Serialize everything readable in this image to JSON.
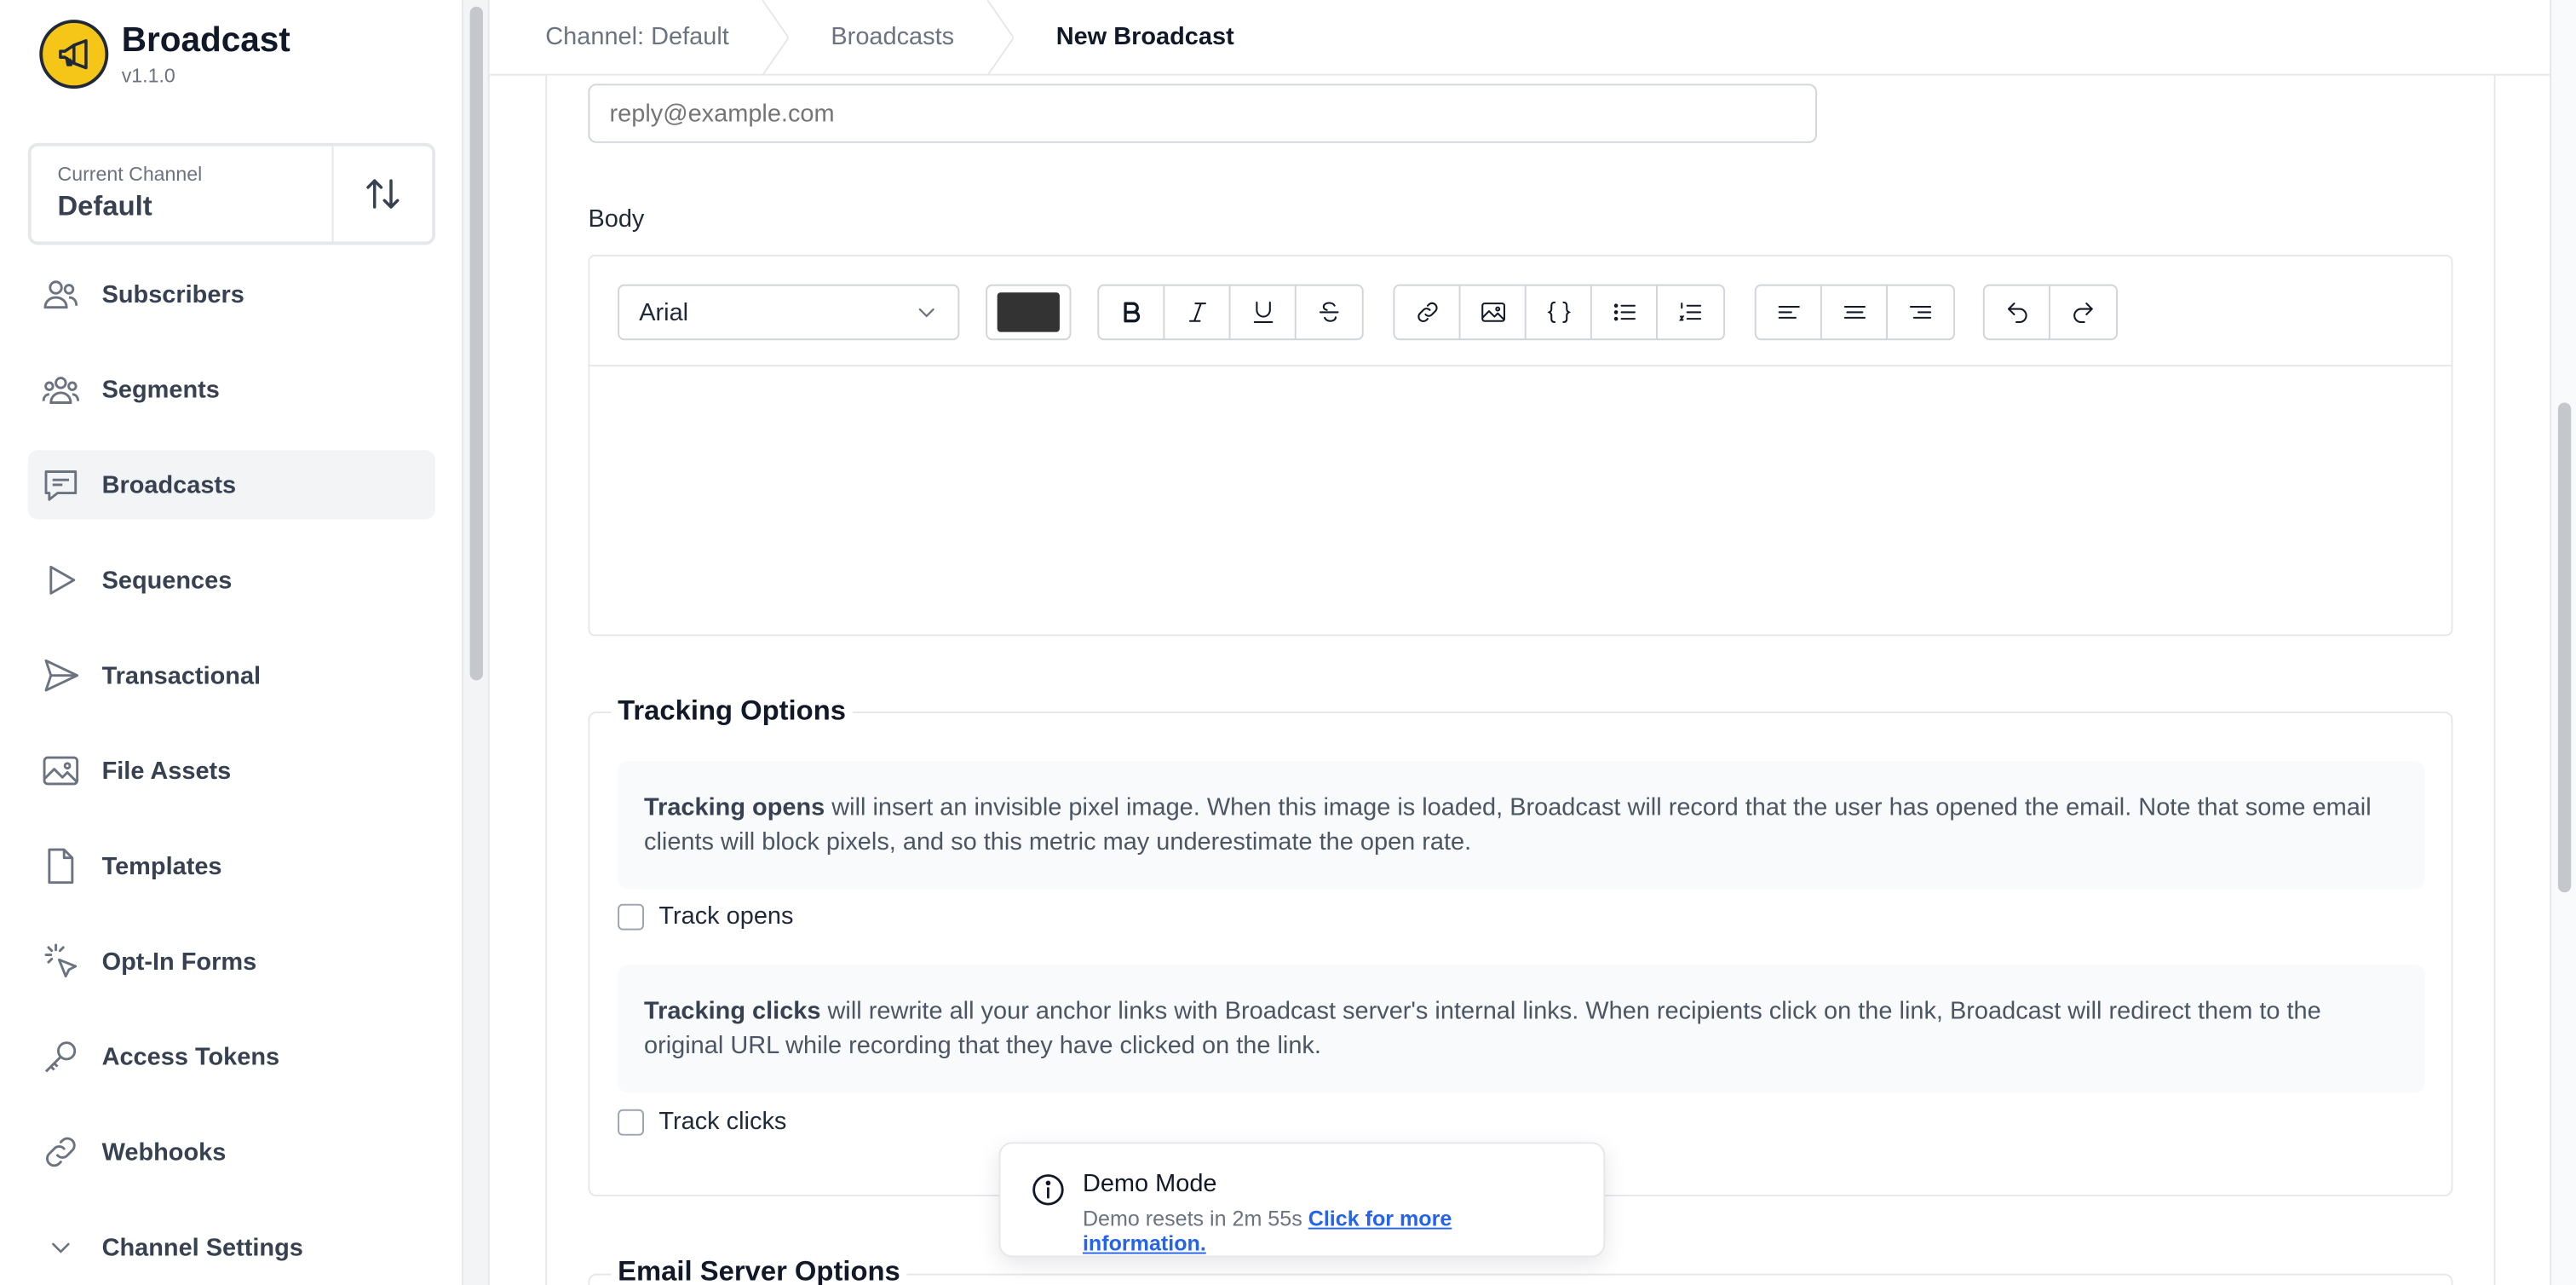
{
  "app": {
    "name": "Broadcast",
    "version": "v1.1.0",
    "brand_color": "#f5c518"
  },
  "channel": {
    "label": "Current Channel",
    "name": "Default",
    "switch_icon": "arrows-up-down-icon"
  },
  "sidebar": {
    "items": [
      {
        "label": "Subscribers",
        "icon": "users-icon"
      },
      {
        "label": "Segments",
        "icon": "user-group-icon"
      },
      {
        "label": "Broadcasts",
        "icon": "chat-bubble-icon",
        "active": true
      },
      {
        "label": "Sequences",
        "icon": "play-icon"
      },
      {
        "label": "Transactional",
        "icon": "paper-airplane-icon"
      },
      {
        "label": "File Assets",
        "icon": "photo-icon"
      },
      {
        "label": "Templates",
        "icon": "document-icon"
      },
      {
        "label": "Opt-In Forms",
        "icon": "cursor-click-icon"
      },
      {
        "label": "Access Tokens",
        "icon": "key-icon"
      },
      {
        "label": "Webhooks",
        "icon": "link-icon"
      },
      {
        "label": "Channel Settings",
        "icon": "chevron-down-icon"
      }
    ]
  },
  "breadcrumb": [
    "Channel: Default",
    "Broadcasts",
    "New Broadcast"
  ],
  "form": {
    "reply_to_placeholder": "reply@example.com",
    "body_label": "Body",
    "editor": {
      "font": "Arial",
      "text_color": "#333333"
    }
  },
  "tracking": {
    "legend": "Tracking Options",
    "opens_bold": "Tracking opens",
    "opens_text": " will insert an invisible pixel image. When this image is loaded, Broadcast will record that the user has opened the email. Note that some email clients will block pixels, and so this metric may underestimate the open rate.",
    "opens_checkbox": "Track opens",
    "clicks_bold": "Tracking clicks",
    "clicks_text": " will rewrite all your anchor links with Broadcast server's internal links. When recipients click on the link, Broadcast will redirect them to the original URL while recording that they have clicked on the link.",
    "clicks_checkbox": "Track clicks"
  },
  "email_server": {
    "legend": "Email Server Options"
  },
  "toast": {
    "title": "Demo Mode",
    "message": "Demo resets in 2m 55s",
    "link": "Click for more information."
  }
}
